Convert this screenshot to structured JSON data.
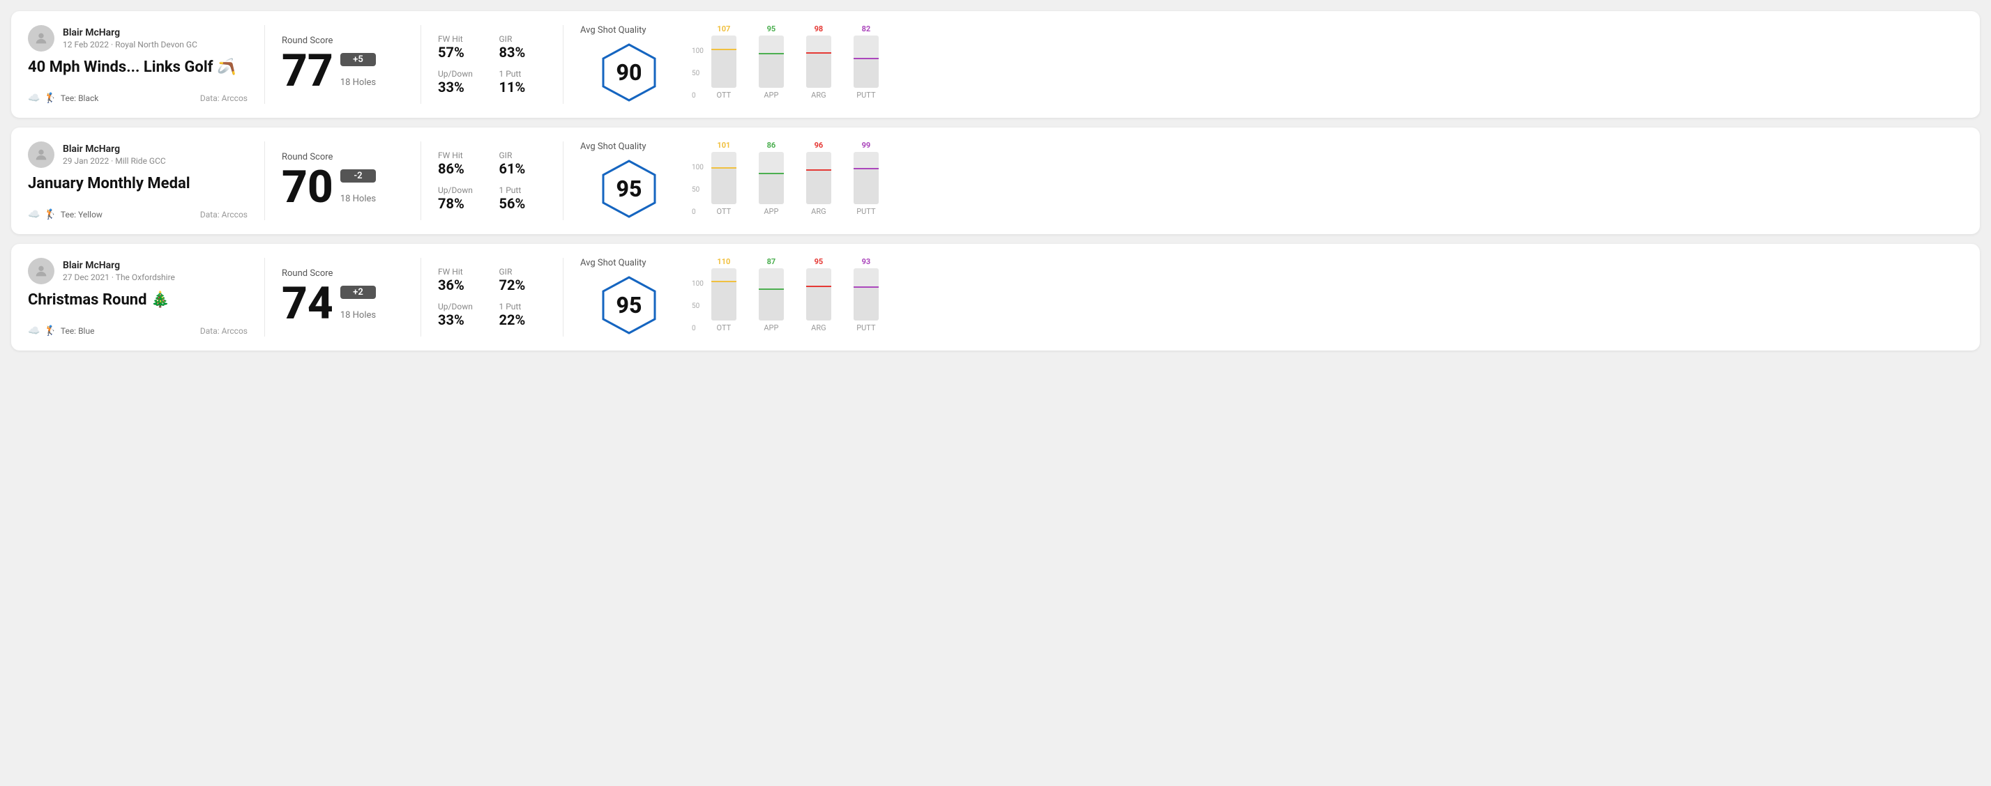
{
  "rounds": [
    {
      "id": "round1",
      "user": {
        "name": "Blair McHarg",
        "date": "12 Feb 2022 · Royal North Devon GC"
      },
      "title": "40 Mph Winds... Links Golf 🪃",
      "tee": "Black",
      "data_source": "Data: Arccos",
      "score": {
        "label": "Round Score",
        "number": "77",
        "badge": "+5",
        "badge_type": "over",
        "holes": "18 Holes"
      },
      "stats": {
        "fw_hit_label": "FW Hit",
        "fw_hit_value": "57%",
        "gir_label": "GIR",
        "gir_value": "83%",
        "updown_label": "Up/Down",
        "updown_value": "33%",
        "putt_label": "1 Putt",
        "putt_value": "11%"
      },
      "quality": {
        "label": "Avg Shot Quality",
        "score": "90",
        "bars": [
          {
            "label": "OTT",
            "value": 107,
            "color": "#f0c040",
            "max": 150
          },
          {
            "label": "APP",
            "value": 95,
            "color": "#4caf50",
            "max": 150
          },
          {
            "label": "ARG",
            "value": 98,
            "color": "#e53935",
            "max": 150
          },
          {
            "label": "PUTT",
            "value": 82,
            "color": "#ab47bc",
            "max": 150
          }
        ]
      }
    },
    {
      "id": "round2",
      "user": {
        "name": "Blair McHarg",
        "date": "29 Jan 2022 · Mill Ride GCC"
      },
      "title": "January Monthly Medal",
      "tee": "Yellow",
      "data_source": "Data: Arccos",
      "score": {
        "label": "Round Score",
        "number": "70",
        "badge": "-2",
        "badge_type": "under",
        "holes": "18 Holes"
      },
      "stats": {
        "fw_hit_label": "FW Hit",
        "fw_hit_value": "86%",
        "gir_label": "GIR",
        "gir_value": "61%",
        "updown_label": "Up/Down",
        "updown_value": "78%",
        "putt_label": "1 Putt",
        "putt_value": "56%"
      },
      "quality": {
        "label": "Avg Shot Quality",
        "score": "95",
        "bars": [
          {
            "label": "OTT",
            "value": 101,
            "color": "#f0c040",
            "max": 150
          },
          {
            "label": "APP",
            "value": 86,
            "color": "#4caf50",
            "max": 150
          },
          {
            "label": "ARG",
            "value": 96,
            "color": "#e53935",
            "max": 150
          },
          {
            "label": "PUTT",
            "value": 99,
            "color": "#ab47bc",
            "max": 150
          }
        ]
      }
    },
    {
      "id": "round3",
      "user": {
        "name": "Blair McHarg",
        "date": "27 Dec 2021 · The Oxfordshire"
      },
      "title": "Christmas Round 🎄",
      "tee": "Blue",
      "data_source": "Data: Arccos",
      "score": {
        "label": "Round Score",
        "number": "74",
        "badge": "+2",
        "badge_type": "over",
        "holes": "18 Holes"
      },
      "stats": {
        "fw_hit_label": "FW Hit",
        "fw_hit_value": "36%",
        "gir_label": "GIR",
        "gir_value": "72%",
        "updown_label": "Up/Down",
        "updown_value": "33%",
        "putt_label": "1 Putt",
        "putt_value": "22%"
      },
      "quality": {
        "label": "Avg Shot Quality",
        "score": "95",
        "bars": [
          {
            "label": "OTT",
            "value": 110,
            "color": "#f0c040",
            "max": 150
          },
          {
            "label": "APP",
            "value": 87,
            "color": "#4caf50",
            "max": 150
          },
          {
            "label": "ARG",
            "value": 95,
            "color": "#e53935",
            "max": 150
          },
          {
            "label": "PUTT",
            "value": 93,
            "color": "#ab47bc",
            "max": 150
          }
        ]
      }
    }
  ],
  "y_axis_labels": [
    "100",
    "50",
    "0"
  ]
}
